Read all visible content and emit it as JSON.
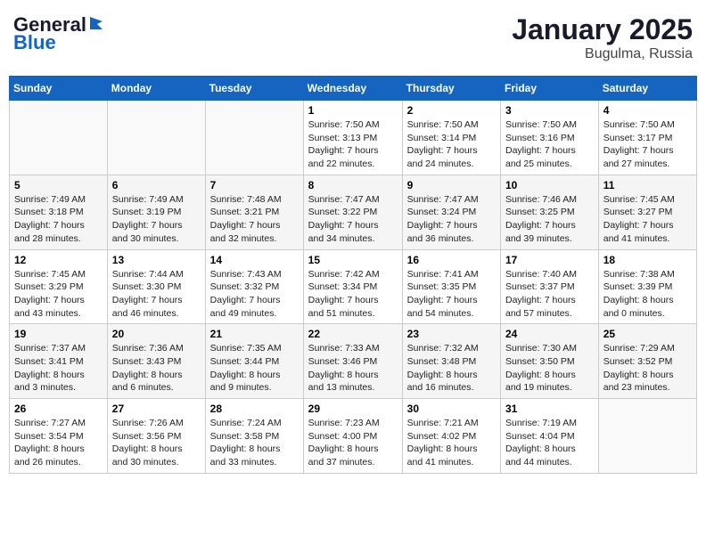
{
  "logo": {
    "line1": "General",
    "line2": "Blue"
  },
  "title": "January 2025",
  "subtitle": "Bugulma, Russia",
  "days_of_week": [
    "Sunday",
    "Monday",
    "Tuesday",
    "Wednesday",
    "Thursday",
    "Friday",
    "Saturday"
  ],
  "weeks": [
    [
      {
        "day": "",
        "info": ""
      },
      {
        "day": "",
        "info": ""
      },
      {
        "day": "",
        "info": ""
      },
      {
        "day": "1",
        "info": "Sunrise: 7:50 AM\nSunset: 3:13 PM\nDaylight: 7 hours\nand 22 minutes."
      },
      {
        "day": "2",
        "info": "Sunrise: 7:50 AM\nSunset: 3:14 PM\nDaylight: 7 hours\nand 24 minutes."
      },
      {
        "day": "3",
        "info": "Sunrise: 7:50 AM\nSunset: 3:16 PM\nDaylight: 7 hours\nand 25 minutes."
      },
      {
        "day": "4",
        "info": "Sunrise: 7:50 AM\nSunset: 3:17 PM\nDaylight: 7 hours\nand 27 minutes."
      }
    ],
    [
      {
        "day": "5",
        "info": "Sunrise: 7:49 AM\nSunset: 3:18 PM\nDaylight: 7 hours\nand 28 minutes."
      },
      {
        "day": "6",
        "info": "Sunrise: 7:49 AM\nSunset: 3:19 PM\nDaylight: 7 hours\nand 30 minutes."
      },
      {
        "day": "7",
        "info": "Sunrise: 7:48 AM\nSunset: 3:21 PM\nDaylight: 7 hours\nand 32 minutes."
      },
      {
        "day": "8",
        "info": "Sunrise: 7:47 AM\nSunset: 3:22 PM\nDaylight: 7 hours\nand 34 minutes."
      },
      {
        "day": "9",
        "info": "Sunrise: 7:47 AM\nSunset: 3:24 PM\nDaylight: 7 hours\nand 36 minutes."
      },
      {
        "day": "10",
        "info": "Sunrise: 7:46 AM\nSunset: 3:25 PM\nDaylight: 7 hours\nand 39 minutes."
      },
      {
        "day": "11",
        "info": "Sunrise: 7:45 AM\nSunset: 3:27 PM\nDaylight: 7 hours\nand 41 minutes."
      }
    ],
    [
      {
        "day": "12",
        "info": "Sunrise: 7:45 AM\nSunset: 3:29 PM\nDaylight: 7 hours\nand 43 minutes."
      },
      {
        "day": "13",
        "info": "Sunrise: 7:44 AM\nSunset: 3:30 PM\nDaylight: 7 hours\nand 46 minutes."
      },
      {
        "day": "14",
        "info": "Sunrise: 7:43 AM\nSunset: 3:32 PM\nDaylight: 7 hours\nand 49 minutes."
      },
      {
        "day": "15",
        "info": "Sunrise: 7:42 AM\nSunset: 3:34 PM\nDaylight: 7 hours\nand 51 minutes."
      },
      {
        "day": "16",
        "info": "Sunrise: 7:41 AM\nSunset: 3:35 PM\nDaylight: 7 hours\nand 54 minutes."
      },
      {
        "day": "17",
        "info": "Sunrise: 7:40 AM\nSunset: 3:37 PM\nDaylight: 7 hours\nand 57 minutes."
      },
      {
        "day": "18",
        "info": "Sunrise: 7:38 AM\nSunset: 3:39 PM\nDaylight: 8 hours\nand 0 minutes."
      }
    ],
    [
      {
        "day": "19",
        "info": "Sunrise: 7:37 AM\nSunset: 3:41 PM\nDaylight: 8 hours\nand 3 minutes."
      },
      {
        "day": "20",
        "info": "Sunrise: 7:36 AM\nSunset: 3:43 PM\nDaylight: 8 hours\nand 6 minutes."
      },
      {
        "day": "21",
        "info": "Sunrise: 7:35 AM\nSunset: 3:44 PM\nDaylight: 8 hours\nand 9 minutes."
      },
      {
        "day": "22",
        "info": "Sunrise: 7:33 AM\nSunset: 3:46 PM\nDaylight: 8 hours\nand 13 minutes."
      },
      {
        "day": "23",
        "info": "Sunrise: 7:32 AM\nSunset: 3:48 PM\nDaylight: 8 hours\nand 16 minutes."
      },
      {
        "day": "24",
        "info": "Sunrise: 7:30 AM\nSunset: 3:50 PM\nDaylight: 8 hours\nand 19 minutes."
      },
      {
        "day": "25",
        "info": "Sunrise: 7:29 AM\nSunset: 3:52 PM\nDaylight: 8 hours\nand 23 minutes."
      }
    ],
    [
      {
        "day": "26",
        "info": "Sunrise: 7:27 AM\nSunset: 3:54 PM\nDaylight: 8 hours\nand 26 minutes."
      },
      {
        "day": "27",
        "info": "Sunrise: 7:26 AM\nSunset: 3:56 PM\nDaylight: 8 hours\nand 30 minutes."
      },
      {
        "day": "28",
        "info": "Sunrise: 7:24 AM\nSunset: 3:58 PM\nDaylight: 8 hours\nand 33 minutes."
      },
      {
        "day": "29",
        "info": "Sunrise: 7:23 AM\nSunset: 4:00 PM\nDaylight: 8 hours\nand 37 minutes."
      },
      {
        "day": "30",
        "info": "Sunrise: 7:21 AM\nSunset: 4:02 PM\nDaylight: 8 hours\nand 41 minutes."
      },
      {
        "day": "31",
        "info": "Sunrise: 7:19 AM\nSunset: 4:04 PM\nDaylight: 8 hours\nand 44 minutes."
      },
      {
        "day": "",
        "info": ""
      }
    ]
  ]
}
